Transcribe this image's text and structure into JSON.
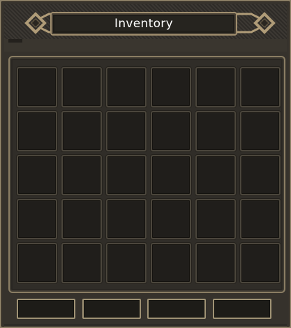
{
  "window": {
    "title": "Inventory",
    "accent_color": "#a08e6e",
    "slot_color": "#201e1b"
  },
  "icons": {
    "left_ornament": "diamond-knot-ornament",
    "right_ornament": "diamond-knot-ornament"
  },
  "grid": {
    "rows": 5,
    "columns": 6,
    "slots": [
      "",
      "",
      "",
      "",
      "",
      "",
      "",
      "",
      "",
      "",
      "",
      "",
      "",
      "",
      "",
      "",
      "",
      "",
      "",
      "",
      "",
      "",
      "",
      "",
      "",
      "",
      "",
      "",
      "",
      ""
    ]
  },
  "bag_tabs": [
    "",
    "",
    "",
    ""
  ]
}
